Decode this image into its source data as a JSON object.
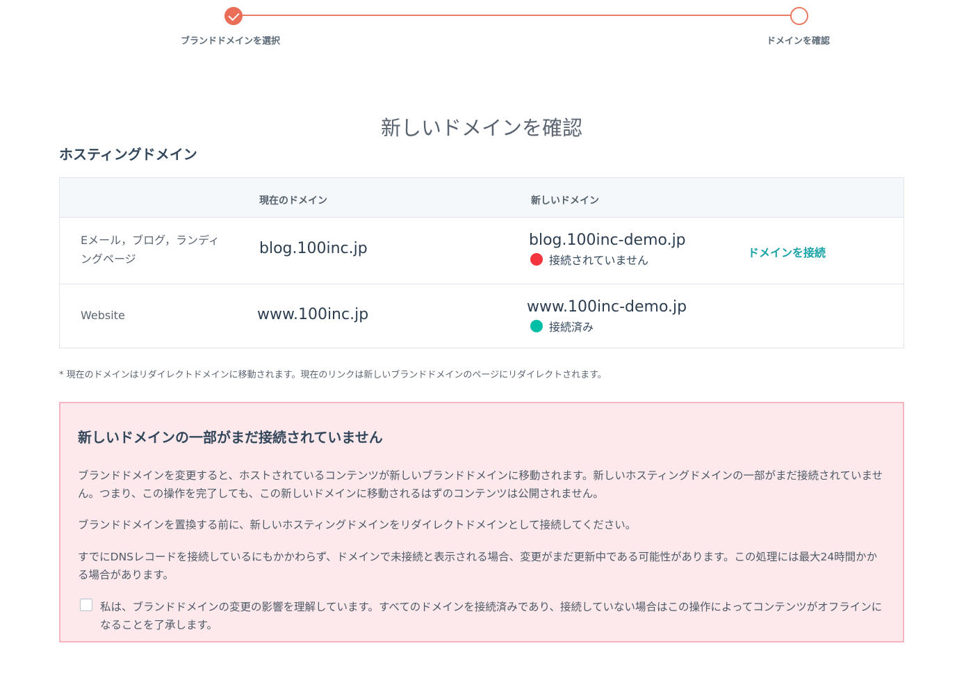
{
  "stepper": {
    "step1_label": "ブランドドメインを選択",
    "step2_label": "ドメインを確認"
  },
  "page_title": "新しいドメインを確認",
  "section_title": "ホスティングドメイン",
  "table": {
    "headers": {
      "use": "",
      "current": "現在のドメイン",
      "new": "新しいドメイン"
    },
    "rows": [
      {
        "use": "Eメール，ブログ，ランディングページ",
        "current": "blog.100inc.jp",
        "new": "blog.100inc-demo.jp",
        "status": "接続されていません",
        "action": "ドメインを接続"
      },
      {
        "use": "Website",
        "current": "www.100inc.jp",
        "new": "www.100inc-demo.jp",
        "status": "接続済み"
      }
    ]
  },
  "footnote": "* 現在のドメインはリダイレクトドメインに移動されます。現在のリンクは新しいブランドドメインのページにリダイレクトされます。",
  "warning": {
    "title": "新しいドメインの一部がまだ接続されていません",
    "p1": "ブランドドメインを変更すると、ホストされているコンテンツが新しいブランドドメインに移動されます。新しいホスティングドメインの一部がまだ接続されていません。つまり、この操作を完了しても、この新しいドメインに移動されるはずのコンテンツは公開されません。",
    "p2": "ブランドドメインを置換する前に、新しいホスティングドメインをリダイレクトドメインとして接続してください。",
    "p3": "すでにDNSレコードを接続しているにもかかわらず、ドメインで未接続と表示される場合、変更がまだ更新中である可能性があります。この処理には最大24時間かかる場合があります。",
    "ack": "私は、ブランドドメインの変更の影響を理解しています。すべてのドメインを接続済みであり、接続していない場合はこの操作によってコンテンツがオフラインになることを了承します。"
  },
  "colors": {
    "accent": "#ea6e57",
    "link": "#1ba3a5",
    "status_error": "#f2353e",
    "status_ok": "#00bda5",
    "warning_bg": "#fde8ec",
    "warning_border": "#f5b4c0"
  }
}
